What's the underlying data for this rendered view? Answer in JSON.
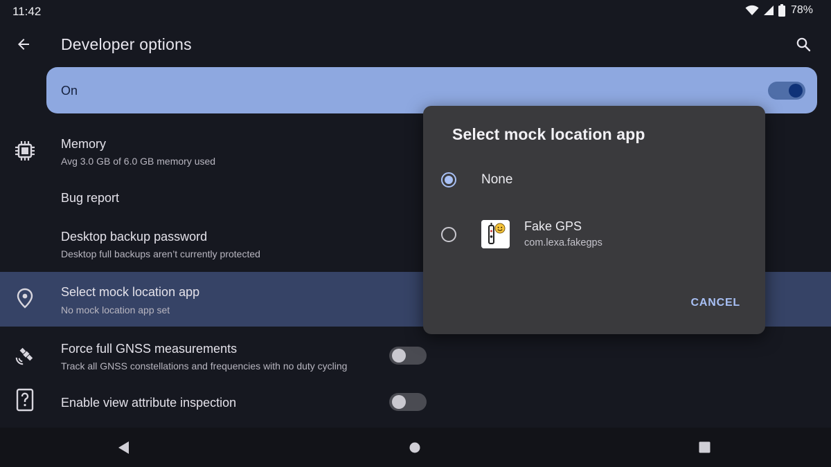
{
  "status_bar": {
    "time": "11:42",
    "battery": "78%",
    "icons": [
      "wifi-icon",
      "cell-signal-icon",
      "battery-icon"
    ]
  },
  "app_bar": {
    "title": "Developer options",
    "back_icon": "arrow-back-icon",
    "search_icon": "search-icon"
  },
  "master_toggle": {
    "label": "On",
    "state": "on"
  },
  "settings": {
    "memory": {
      "title": "Memory",
      "summary": "Avg 3.0 GB of 6.0 GB memory used",
      "icon": "memory-chip-icon"
    },
    "bug_report": {
      "title": "Bug report"
    },
    "backup_password": {
      "title": "Desktop backup password",
      "summary": "Desktop full backups aren’t currently protected"
    },
    "mock_location": {
      "title": "Select mock location app",
      "summary": "No mock location app set",
      "icon": "location-pin-icon"
    },
    "gnss": {
      "title": "Force full GNSS measurements",
      "summary": "Track all GNSS constellations and frequencies with no duty cycling",
      "icon": "satellite-icon",
      "state": "off"
    },
    "view_attr": {
      "title": "Enable view attribute inspection",
      "icon": "help-box-icon",
      "state": "off"
    }
  },
  "dialog": {
    "title": "Select mock location app",
    "options": [
      {
        "label": "None",
        "selected": true
      },
      {
        "name": "Fake GPS",
        "package": "com.lexa.fakegps",
        "icon": "fake-gps-app-icon",
        "selected": false
      }
    ],
    "cancel_label": "CANCEL"
  },
  "nav_bar": {
    "icons": [
      "nav-back-icon",
      "nav-home-icon",
      "nav-recents-icon"
    ]
  },
  "colors": {
    "background": "#161820",
    "master_card": "#8ea8e0",
    "highlight_row": "#364366",
    "dialog": "#3a3a3d",
    "accent": "#a8c0f5"
  }
}
